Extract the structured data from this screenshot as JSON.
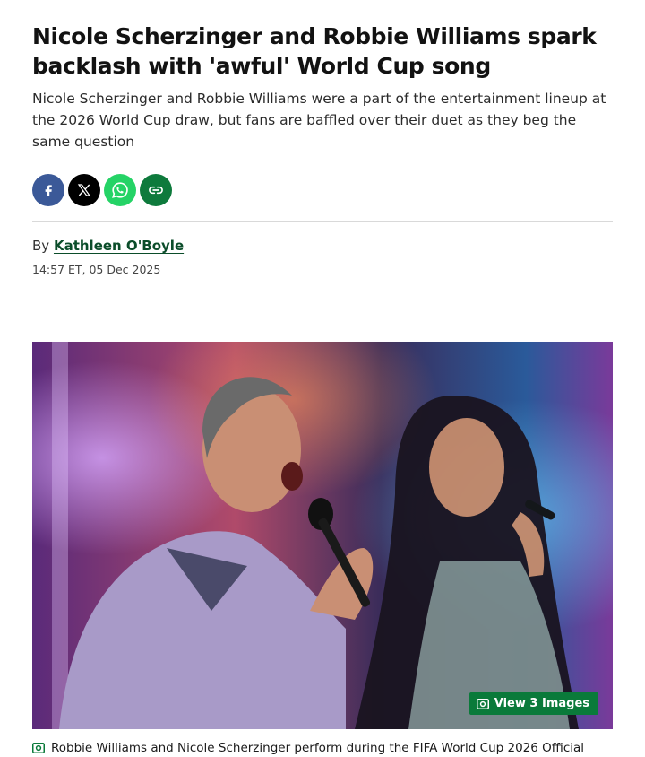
{
  "article": {
    "headline": "Nicole Scherzinger and Robbie Williams spark backlash with 'awful' World Cup song",
    "standfirst": "Nicole Scherzinger and Robbie Williams were a part of the entertainment lineup at the 2026 World Cup draw, but fans are baffled over their duet as they beg the same question",
    "byline_prefix": "By",
    "author": "Kathleen O'Boyle",
    "timestamp": "14:57 ET, 05 Dec 2025"
  },
  "share": {
    "icons": [
      "facebook-icon",
      "x-icon",
      "whatsapp-icon",
      "link-icon"
    ]
  },
  "hero": {
    "view_images_label": "View 3 Images",
    "caption": "Robbie Williams and Nicole Scherzinger perform during the FIFA World Cup 2026 Official"
  },
  "colors": {
    "accent": "#0a7a3a",
    "author_link": "#0b4d2a",
    "facebook": "#3b5998",
    "x": "#000000",
    "whatsapp": "#25d366",
    "link": "#0e7a3c"
  }
}
